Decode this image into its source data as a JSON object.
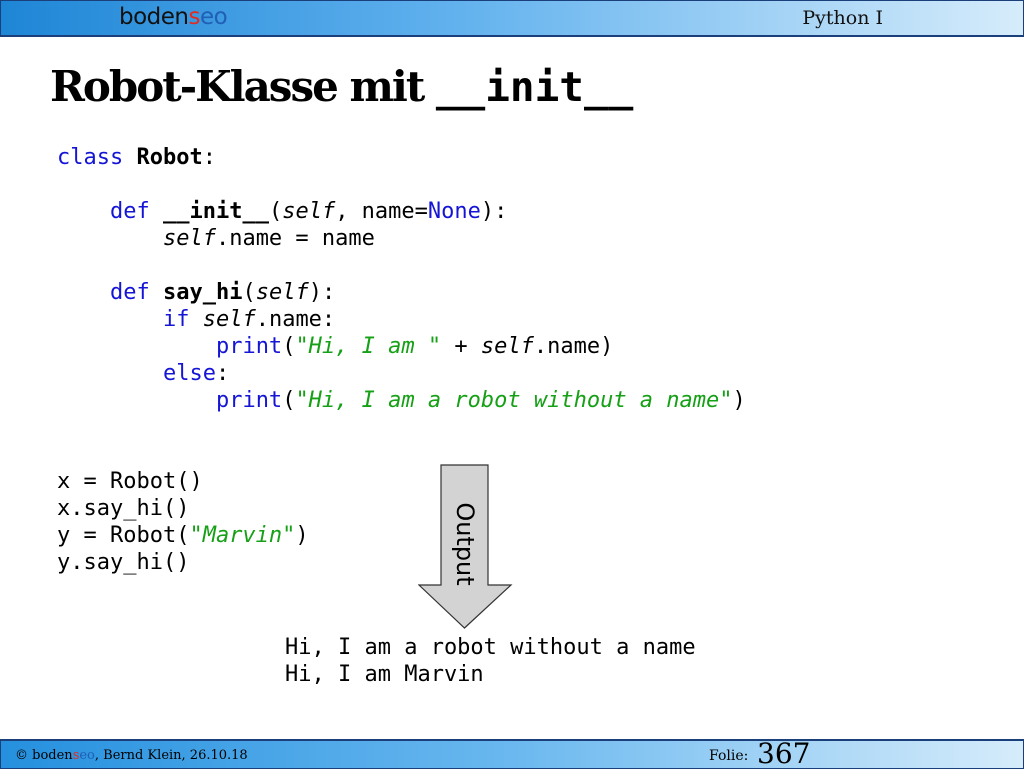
{
  "header": {
    "logo": {
      "part1": "boden",
      "part2": "s",
      "part3": "eo"
    },
    "course": "Python I"
  },
  "slide": {
    "title": "Robot-Klasse mit",
    "title_code": "__init__"
  },
  "code": {
    "l1": {
      "kw": "class",
      "name": "Robot",
      "end": ":"
    },
    "l3": {
      "kw": "def",
      "name": "__init__",
      "open": "(",
      "self": "self",
      "mid": ", name=",
      "none": "None",
      "end": "):"
    },
    "l4": {
      "self": "self",
      "rest": ".name = name"
    },
    "l6": {
      "kw": "def",
      "name": "say_hi",
      "open": "(",
      "self": "self",
      "end": "):"
    },
    "l7": {
      "kw": "if",
      "self": "self",
      "rest": ".name:"
    },
    "l8": {
      "fn": "print",
      "open": "(",
      "str": "\"Hi, I am \"",
      "mid": " + ",
      "self": "self",
      "end": ".name)"
    },
    "l9": {
      "kw": "else",
      "end": ":"
    },
    "l10": {
      "fn": "print",
      "open": "(",
      "str": "\"Hi, I am a robot without a name\"",
      "end": ")"
    },
    "l13": "x = Robot()",
    "l14": "x.say_hi()",
    "l15": {
      "pre": "y = Robot(",
      "str": "\"Marvin\"",
      "end": ")"
    },
    "l16": "y.say_hi()"
  },
  "arrow": {
    "label": "Output",
    "fill": "#d3d3d3"
  },
  "output": {
    "line1": "Hi, I am a robot without a name",
    "line2": "Hi, I am Marvin"
  },
  "footer": {
    "copyright": "©",
    "logo": {
      "part1": "boden",
      "part2": "s",
      "part3": "eo"
    },
    "author_date": ", Bernd Klein, 26.10.18",
    "folie_label": "Folie:",
    "page": "367"
  }
}
